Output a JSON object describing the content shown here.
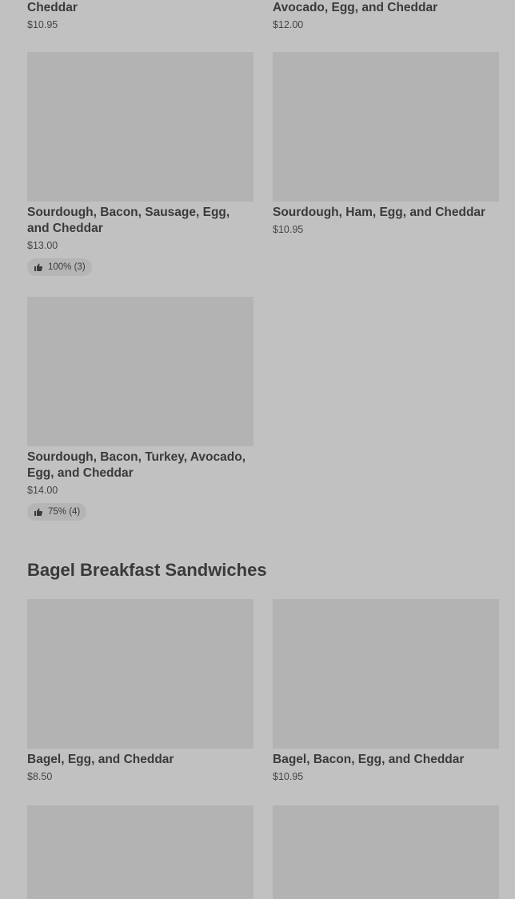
{
  "top_partial": [
    {
      "name_tail": "Cheddar",
      "price": "$10.95"
    },
    {
      "name_tail": "Avocado, Egg, and Cheddar",
      "price": "$12.00"
    }
  ],
  "items": [
    {
      "name": "Sourdough, Bacon, Sausage, Egg, and Cheddar",
      "price": "$13.00",
      "rating": "100% (3)"
    },
    {
      "name": "Sourdough, Ham, Egg, and Cheddar",
      "price": "$10.95"
    },
    {
      "name": "Sourdough, Bacon, Turkey, Avocado, Egg, and Cheddar",
      "price": "$14.00",
      "rating": "75% (4)"
    }
  ],
  "section": {
    "title": "Bagel Breakfast Sandwiches"
  },
  "bagel_items": [
    {
      "name": "Bagel, Egg, and Cheddar",
      "price": "$8.50"
    },
    {
      "name": "Bagel, Bacon, Egg, and Cheddar",
      "price": "$10.95"
    }
  ],
  "icons": {
    "rating": "thumbs-up-icon"
  }
}
